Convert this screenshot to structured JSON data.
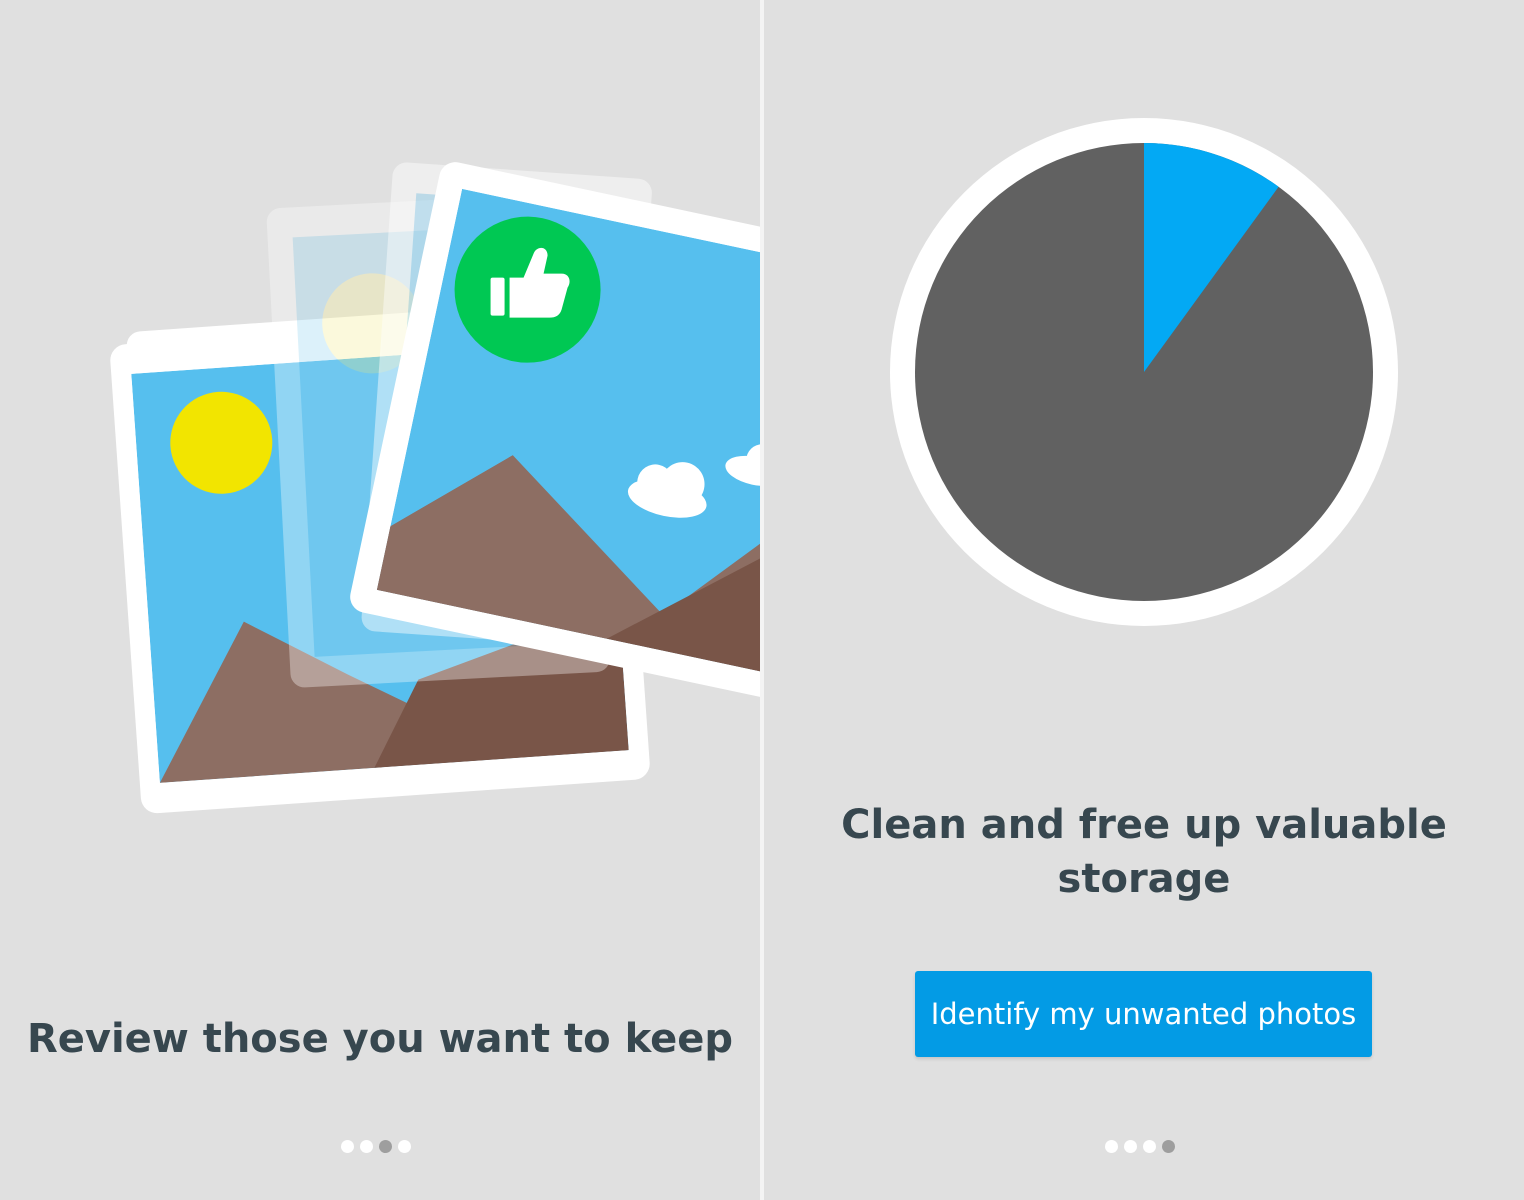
{
  "screens": [
    {
      "title": "Review those you want to keep",
      "pager": {
        "count": 4,
        "active_index": 2
      }
    },
    {
      "title": "Clean and free up valuable storage",
      "button_label": "Identify my unwanted photos",
      "pager": {
        "count": 4,
        "active_index": 3
      },
      "storage_chart": {
        "type": "pie",
        "highlighted_fraction": 0.1,
        "colors": {
          "highlight": "#03a9f4",
          "rest": "#616161",
          "ring": "#ffffff"
        }
      }
    }
  ],
  "colors": {
    "background": "#e0e0e0",
    "text": "#37474f",
    "accent": "#039be5",
    "sky": "#56bfee",
    "sun": "#f2e500",
    "mountain_light": "#8d6e63",
    "mountain_dark": "#795548",
    "keep_badge": "#00c853"
  },
  "icons": [
    "photo-stack-icon",
    "thumbs-up-icon",
    "pie-chart-icon"
  ]
}
